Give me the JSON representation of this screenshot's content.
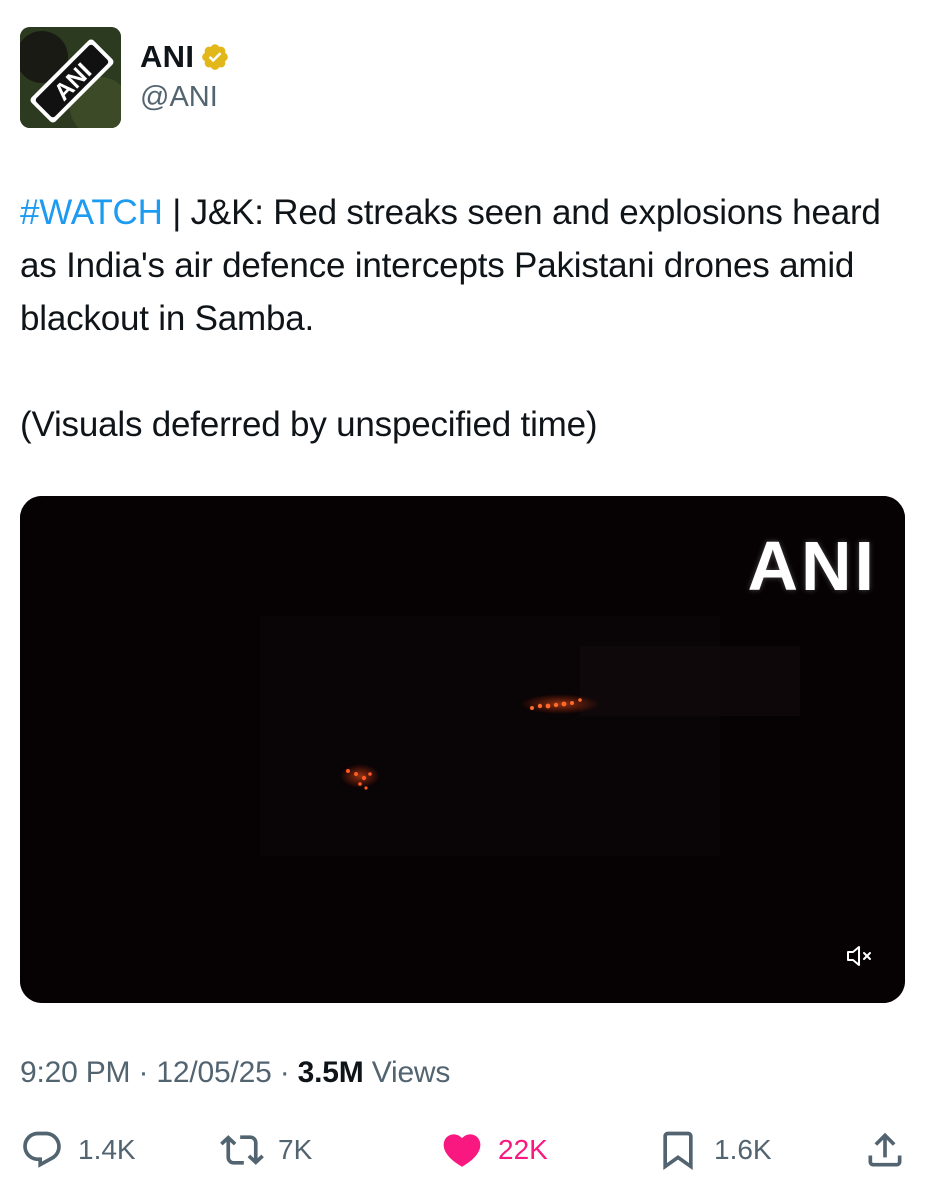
{
  "author": {
    "display_name": "ANI",
    "handle": "@ANI",
    "verified": true,
    "avatar_text": "ANI"
  },
  "tweet": {
    "hashtag": "#WATCH",
    "text_main": " | J&K: Red streaks seen and explosions heard as India's air defence intercepts Pakistani drones amid blackout in Samba.",
    "text_note": "(Visuals deferred by unspecified time)"
  },
  "media": {
    "watermark": "ANI",
    "mute_icon": "speaker-muted-icon"
  },
  "meta": {
    "time": "9:20 PM",
    "date": "12/05/25",
    "separator": "·",
    "views_count": "3.5M",
    "views_label": "Views"
  },
  "actions": {
    "replies": "1.4K",
    "reposts": "7K",
    "likes": "22K",
    "bookmarks": "1.6K"
  },
  "colors": {
    "accent": "#1d9bf0",
    "like": "#f91880",
    "secondary_text": "#536471",
    "verified_gold": "#e2b719"
  }
}
